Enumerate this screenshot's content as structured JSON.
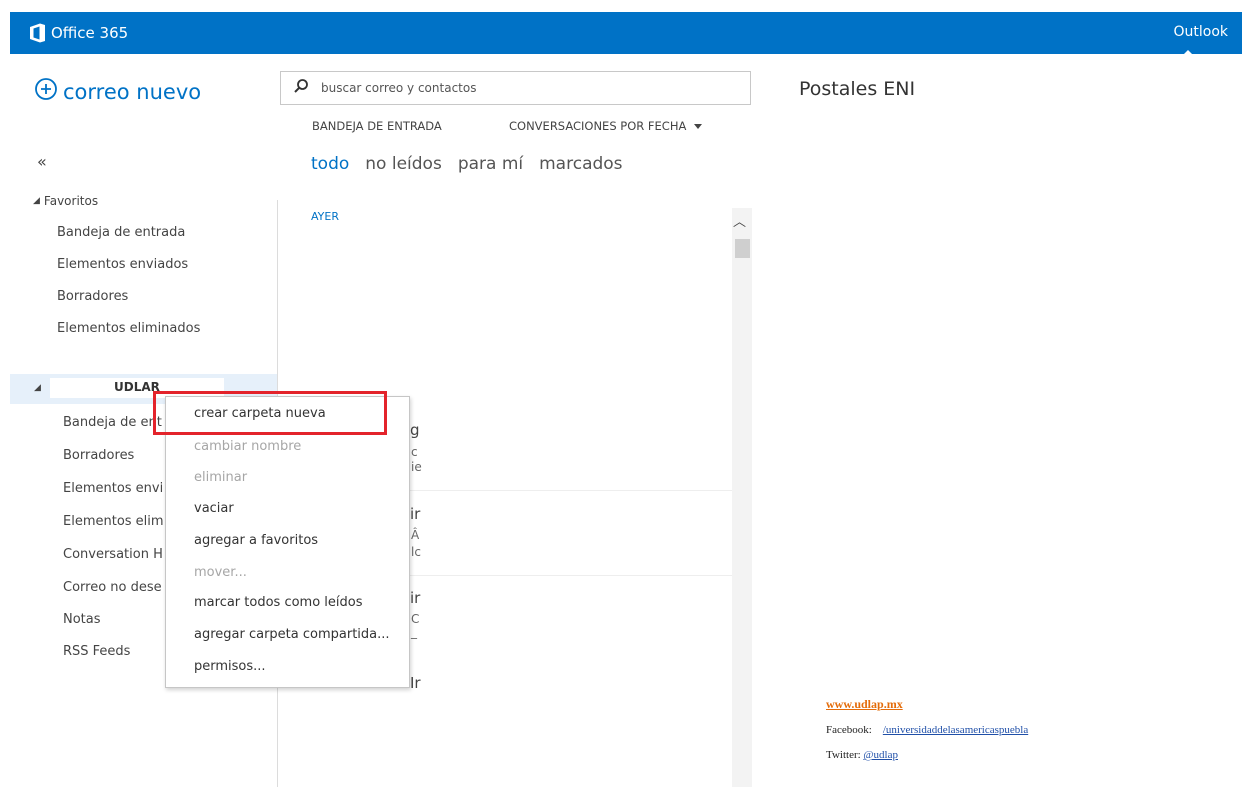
{
  "app": {
    "brand": "Office 365",
    "app_link": "Outlook"
  },
  "compose": {
    "label": "correo nuevo"
  },
  "nav": {
    "collapse_glyph": "«",
    "favorites": {
      "title": "Favoritos",
      "items": [
        "Bandeja de entrada",
        "Elementos enviados",
        "Borradores",
        "Elementos eliminados"
      ]
    },
    "account": {
      "name": "UDLAR",
      "folders": [
        "Bandeja de ent",
        "Borradores",
        "Elementos envi",
        "Elementos elim",
        "Conversation H",
        "Correo no dese",
        "Notas",
        "RSS Feeds"
      ]
    }
  },
  "search": {
    "placeholder": "buscar correo y contactos"
  },
  "list": {
    "folder": "BANDEJA DE ENTRADA",
    "sort": "CONVERSACIONES POR FECHA",
    "filters": [
      "todo",
      "no leídos",
      "para mí",
      "marcados"
    ],
    "group": "AYER",
    "snippets": [
      "g",
      "c",
      "ie",
      "ir",
      "Â",
      "lc",
      "ir",
      "C",
      "_",
      "Ir"
    ]
  },
  "context_menu": {
    "items": [
      {
        "label": "crear carpeta nueva",
        "enabled": true
      },
      {
        "label": "cambiar nombre",
        "enabled": false
      },
      {
        "label": "eliminar",
        "enabled": false
      },
      {
        "label": "vaciar",
        "enabled": true
      },
      {
        "label": "agregar a favoritos",
        "enabled": true
      },
      {
        "label": "mover...",
        "enabled": false
      },
      {
        "label": "marcar todos como leídos",
        "enabled": true
      },
      {
        "label": "agregar carpeta compartida...",
        "enabled": true
      },
      {
        "label": "permisos...",
        "enabled": true
      }
    ]
  },
  "reading_pane": {
    "title": "Postales ENI",
    "signature": {
      "website": "www.udlap.mx",
      "facebook_label": "Facebook:",
      "facebook_value": "/universidaddelasamericaspuebla",
      "twitter_label": "Twitter:",
      "twitter_value": "@udlap"
    }
  },
  "colors": {
    "brand_blue": "#0072c6",
    "highlight_red": "#e3232b",
    "signature_orange": "#e46c0a"
  },
  "icons": {
    "logo": "office-logo-icon",
    "compose": "plus-circle-icon",
    "search": "search-icon",
    "collapse": "double-chevron-left-icon"
  }
}
